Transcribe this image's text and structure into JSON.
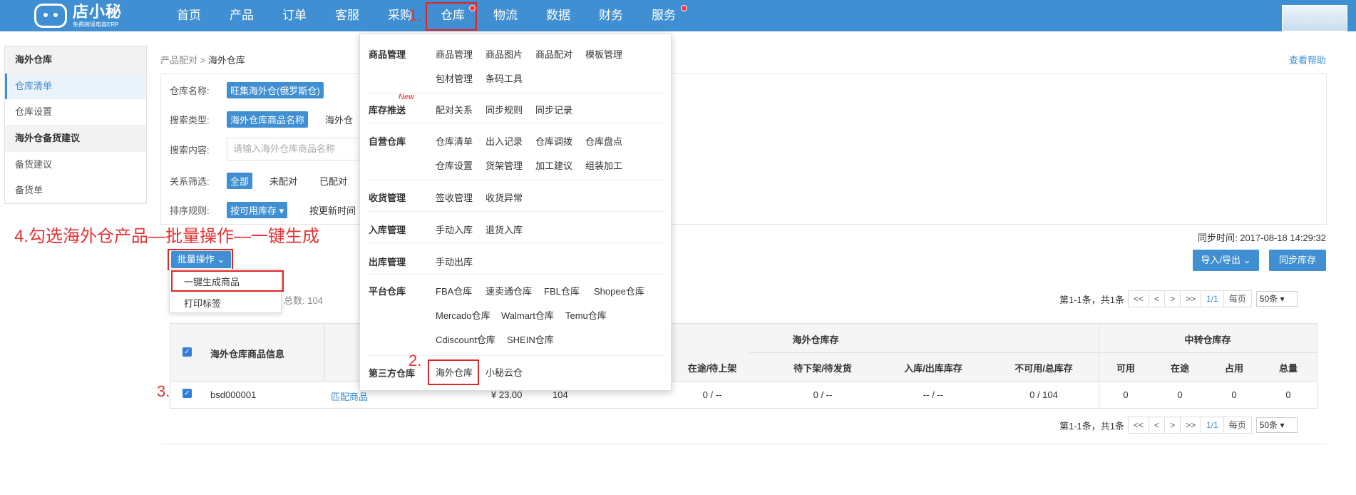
{
  "nav": {
    "logo_name": "店小秘",
    "logo_slogan": "免费跨境电商ERP",
    "items": [
      "首页",
      "产品",
      "订单",
      "客服",
      "采购",
      "仓库",
      "物流",
      "数据",
      "财务",
      "服务"
    ]
  },
  "sidebar": {
    "group1": "海外仓库",
    "item_list": "仓库清单",
    "item_settings": "仓库设置",
    "group2": "海外仓备货建议",
    "item_suggest": "备货建议",
    "item_order": "备货单"
  },
  "breadcrumb": {
    "parent": "产品配对",
    "sep": ">",
    "current": "海外仓库"
  },
  "help": "查看帮助",
  "filters": {
    "warehouse_label": "仓库名称:",
    "warehouse_value": "旺集海外仓(俄罗斯仓)",
    "search_type_label": "搜索类型:",
    "search_type_active": "海外仓库商品名称",
    "search_type_other": "海外仓",
    "search_content_label": "搜索内容:",
    "search_placeholder": "请输入海外仓库商品名称",
    "relation_label": "关系筛选:",
    "relation_all": "全部",
    "relation_unmatched": "未配对",
    "relation_matched": "已配对",
    "sort_label": "排序规则:",
    "sort_active": "按可用库存 ▾",
    "sort_other": "按更新时间"
  },
  "annotations": {
    "step1": "1.",
    "step2": "2.",
    "step3": "3.",
    "step4": "4.勾选海外仓产品—批量操作—一键生成"
  },
  "toolbar": {
    "bulk": "批量操作",
    "bulk_generate": "一键生成商品",
    "bulk_print": "打印标签",
    "total_text": "总数: 104",
    "sync_time": "同步时间: 2017-08-18 14:29:32",
    "import_export": "导入/导出",
    "sync_stock": "同步库存"
  },
  "pager": {
    "summary": "第1-1条，共1条",
    "first": "<<",
    "prev": "<",
    "next": ">",
    "last": ">>",
    "page": "1/1",
    "per_page_label": "每页",
    "per_page_value": "50条"
  },
  "table": {
    "col_info": "海外仓库商品信息",
    "group_overseas": "海外仓库存",
    "group_transit": "中转仓库存",
    "col_intransit": "在途/待上架",
    "col_pending": "待下架/待发货",
    "col_inout": "入库/出库库存",
    "col_unavailable": "不可用/总库存",
    "col_available": "可用",
    "col_onway": "在途",
    "col_occupied": "占用",
    "col_total": "总量",
    "row": {
      "sku": "bsd000001",
      "match": "匹配商品",
      "price": "¥ 23.00",
      "available": "104",
      "intransit": "0 / --",
      "pending": "0 / --",
      "inout": "-- / --",
      "unavailable": "0 / 104",
      "t_available": "0",
      "t_onway": "0",
      "t_occupied": "0",
      "t_total": "0"
    }
  },
  "mega_menu": {
    "new_badge": "New",
    "sections": [
      {
        "title": "商品管理",
        "links": [
          "商品管理",
          "商品图片",
          "商品配对",
          "模板管理",
          "包材管理",
          "条码工具"
        ]
      },
      {
        "title": "库存推送",
        "links": [
          "配对关系",
          "同步规则",
          "同步记录"
        ]
      },
      {
        "title": "自营仓库",
        "links": [
          "仓库清单",
          "出入记录",
          "仓库调拨",
          "仓库盘点",
          "仓库设置",
          "货架管理",
          "加工建议",
          "组装加工"
        ]
      },
      {
        "title": "收货管理",
        "links": [
          "签收管理",
          "收货异常"
        ]
      },
      {
        "title": "入库管理",
        "links": [
          "手动入库",
          "退货入库"
        ]
      },
      {
        "title": "出库管理",
        "links": [
          "手动出库"
        ]
      },
      {
        "title": "平台仓库",
        "links": [
          "FBA仓库",
          "速卖通仓库",
          "FBL仓库",
          "Shopee仓库",
          "Mercado仓库",
          "Walmart仓库",
          "Temu仓库",
          "Cdiscount仓库",
          "SHEIN仓库"
        ]
      },
      {
        "title": "第三方仓库",
        "links": [
          "海外仓库",
          "小秘云仓"
        ]
      }
    ]
  }
}
